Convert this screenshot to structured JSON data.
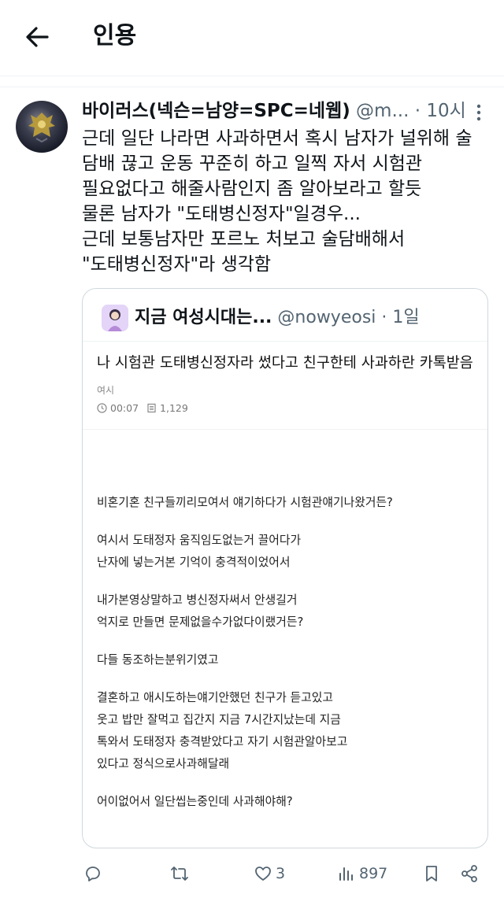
{
  "header": {
    "title": "인용"
  },
  "tweet": {
    "author_name": "바이러스(넥슨=남양=SPC=네웹)",
    "handle": " @m...",
    "time": " · 10시",
    "lines": [
      "근데 일단 나라면 사과하면서 혹시 남자가 널위해 술",
      "담배 끊고 운동 꾸준히 하고 일찍 자서 시험관",
      "필요없다고 해줄사람인지 좀 알아보라고 할듯",
      "물론 남자가 \"도태병신정자\"일경우...",
      "근데 보통남자만 포르노 처보고 술담배해서",
      "\"도태병신정자\"라 생각함"
    ]
  },
  "quote": {
    "name": "지금 여성시대는...",
    "handle": " @nowyeosi · 1일",
    "title": "나 시험관 도태병신정자라 썼다고 친구한테 사과하란 카톡받음",
    "source": "여시",
    "time": "00:07",
    "views": "1,129",
    "paragraphs": [
      [
        "비혼기혼 친구들끼리모여서 얘기하다가 시험관얘기나왔거든?"
      ],
      [
        "여시서 도태정자 움직임도없는거 끌어다가",
        "난자에 넣는거본 기억이 충격적이었어서"
      ],
      [
        "내가본영상말하고 병신정자써서 안생길거",
        "억지로 만들면 문제없을수가없다이랬거든?"
      ],
      [
        "다들 동조하는분위기였고"
      ],
      [
        "결혼하고 애시도하는얘기안했던 친구가 듣고있고",
        "웃고 밥만 잘먹고 집간지 지금 7시간지났는데 지금",
        "톡와서 도태정자 충격받았다고 자기 시험관알아보고",
        "있다고 정식으로사과해달래"
      ],
      [
        "어이없어서 일단씹는중인데 사과해야해?"
      ]
    ]
  },
  "actions": {
    "likes": "3",
    "views": "897"
  },
  "icons": [
    "back-arrow-icon",
    "more-vertical-icon",
    "reply-icon",
    "retweet-icon",
    "heart-icon",
    "views-icon",
    "bookmark-icon",
    "share-icon",
    "clock-icon",
    "document-icon"
  ]
}
